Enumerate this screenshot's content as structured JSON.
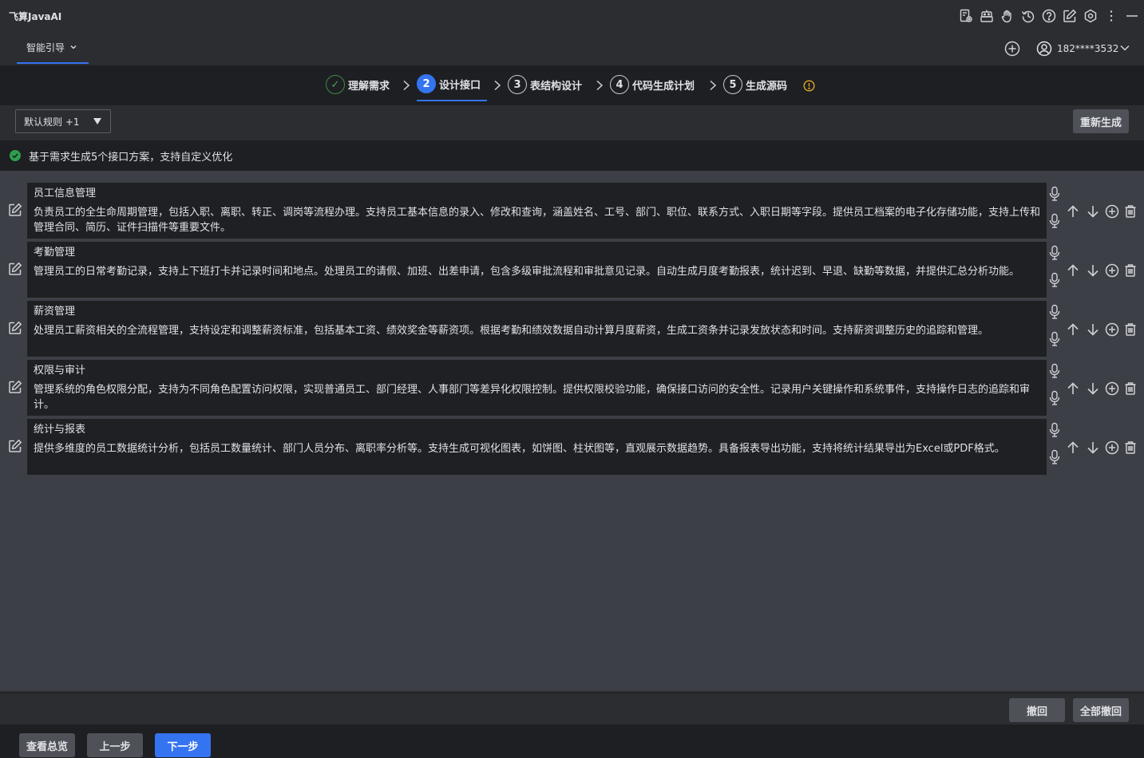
{
  "app": {
    "title": "飞算JavaAI"
  },
  "nav": {
    "tab_label": "智能引导",
    "user": "182****3532"
  },
  "steps": [
    {
      "num": "✓",
      "label": "理解需求",
      "state": "done"
    },
    {
      "num": "2",
      "label": "设计接口",
      "state": "active"
    },
    {
      "num": "3",
      "label": "表结构设计",
      "state": "todo"
    },
    {
      "num": "4",
      "label": "代码生成计划",
      "state": "todo"
    },
    {
      "num": "5",
      "label": "生成源码",
      "state": "todo"
    }
  ],
  "rules": {
    "selected": "默认规则 +1",
    "regenerate_label": "重新生成"
  },
  "notice": {
    "text": "基于需求生成5个接口方案，支持自定义优化"
  },
  "interfaces": [
    {
      "title": "员工信息管理",
      "desc": "负责员工的全生命周期管理，包括入职、离职、转正、调岗等流程办理。支持员工基本信息的录入、修改和查询，涵盖姓名、工号、部门、职位、联系方式、入职日期等字段。提供员工档案的电子化存储功能，支持上传和管理合同、简历、证件扫描件等重要文件。"
    },
    {
      "title": "考勤管理",
      "desc": "管理员工的日常考勤记录，支持上下班打卡并记录时间和地点。处理员工的请假、加班、出差申请，包含多级审批流程和审批意见记录。自动生成月度考勤报表，统计迟到、早退、缺勤等数据，并提供汇总分析功能。"
    },
    {
      "title": "薪资管理",
      "desc": "处理员工薪资相关的全流程管理，支持设定和调整薪资标准，包括基本工资、绩效奖金等薪资项。根据考勤和绩效数据自动计算月度薪资，生成工资条并记录发放状态和时间。支持薪资调整历史的追踪和管理。"
    },
    {
      "title": "权限与审计",
      "desc": "管理系统的角色权限分配，支持为不同角色配置访问权限，实现普通员工、部门经理、人事部门等差异化权限控制。提供权限校验功能，确保接口访问的安全性。记录用户关键操作和系统事件，支持操作日志的追踪和审计。"
    },
    {
      "title": "统计与报表",
      "desc": "提供多维度的员工数据统计分析，包括员工数量统计、部门人员分布、离职率分析等。支持生成可视化图表，如饼图、柱状图等，直观展示数据趋势。具备报表导出功能，支持将统计结果导出为Excel或PDF格式。"
    }
  ],
  "history": {
    "undo_label": "撤回",
    "undo_all_label": "全部撤回"
  },
  "footer": {
    "overview_label": "查看总览",
    "prev_label": "上一步",
    "next_label": "下一步"
  },
  "colors": {
    "accent": "#3574f0",
    "success": "#2e9e4f",
    "warning": "#e0a624"
  }
}
